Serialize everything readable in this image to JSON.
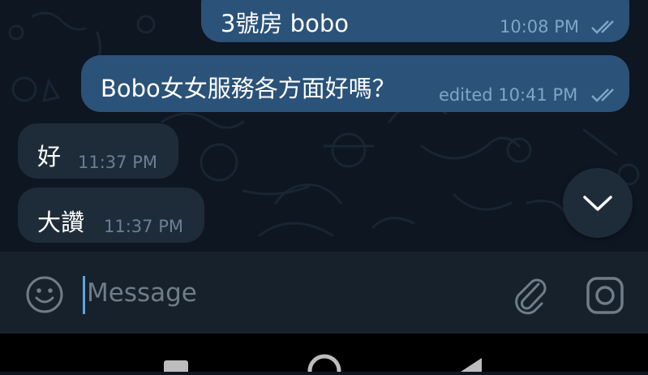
{
  "messages": [
    {
      "text": "3號房 bobo",
      "time": "10:08 PM",
      "direction": "outgoing",
      "status": "read"
    },
    {
      "text": "Bobo女女服務各方面好嗎？",
      "time": "edited 10:41 PM",
      "direction": "outgoing",
      "status": "read"
    },
    {
      "text": "好",
      "time": "11:37 PM",
      "direction": "incoming"
    },
    {
      "text": "大讚",
      "time": "11:37 PM",
      "direction": "incoming"
    }
  ],
  "composer": {
    "placeholder": "Message",
    "emoji_icon": "emoji-icon",
    "attach_icon": "paperclip-icon",
    "camera_icon": "instagram-camera-icon"
  },
  "scroll_button_icon": "chevron-down-icon",
  "colors": {
    "background": "#0e1621",
    "outgoing_bubble": "#2b5278",
    "incoming_bubble": "#1e2c3a",
    "composer_bar": "#17212b",
    "accent": "#5aa5e6"
  }
}
